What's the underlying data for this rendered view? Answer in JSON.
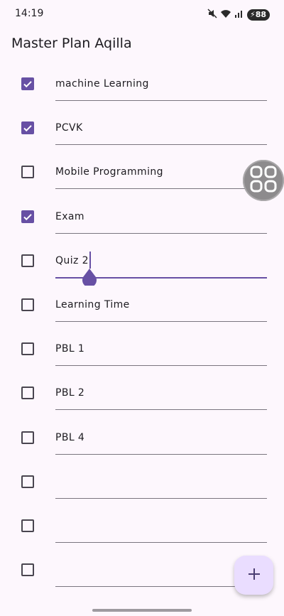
{
  "status_bar": {
    "time": "14:19",
    "battery": "88"
  },
  "app": {
    "title": "Master Plan Aqilla"
  },
  "tasks": [
    {
      "text": "machine Learning",
      "checked": true
    },
    {
      "text": "PCVK",
      "checked": true
    },
    {
      "text": "Mobile Programming",
      "checked": false
    },
    {
      "text": "Exam",
      "checked": true
    },
    {
      "text": "Quiz 2",
      "checked": false,
      "focused": true
    },
    {
      "text": "Learning Time",
      "checked": false
    },
    {
      "text": "PBL 1",
      "checked": false
    },
    {
      "text": "PBL 2",
      "checked": false
    },
    {
      "text": "PBL 4",
      "checked": false
    },
    {
      "text": "",
      "checked": false
    },
    {
      "text": "",
      "checked": false
    },
    {
      "text": "",
      "checked": false
    }
  ],
  "colors": {
    "accent": "#6750a4",
    "fab": "#eaddff",
    "background": "#fdf7fd"
  },
  "icons": {
    "fab": "add-icon",
    "assist": "grid-icon"
  }
}
